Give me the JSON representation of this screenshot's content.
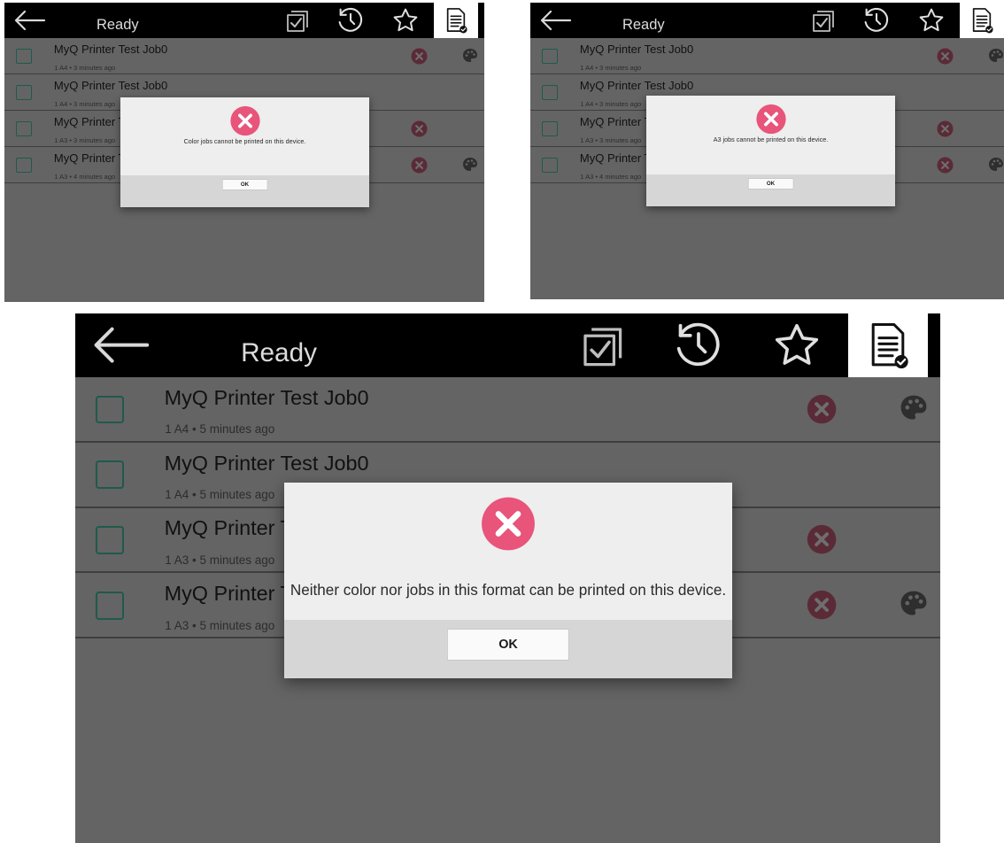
{
  "screens": [
    {
      "topbar": {
        "title": "Ready"
      },
      "jobs": [
        {
          "name": "MyQ Printer Test Job0",
          "meta": "1 A4 • 3 minutes ago",
          "error": true,
          "color": true
        },
        {
          "name": "MyQ Printer Test Job0",
          "meta": "1 A4 • 3 minutes ago",
          "error": false,
          "color": false
        },
        {
          "name": "MyQ Printer Te",
          "meta": "1 A3 • 3 minutes ago",
          "error": true,
          "color": false
        },
        {
          "name": "MyQ Printer Te",
          "meta": "1 A3 • 4 minutes ago",
          "error": true,
          "color": true
        }
      ],
      "dialog": {
        "icon": "error-icon",
        "message": "Color jobs cannot be printed on this device.",
        "ok_label": "OK"
      }
    },
    {
      "topbar": {
        "title": "Ready"
      },
      "jobs": [
        {
          "name": "MyQ Printer Test Job0",
          "meta": "1 A4 • 3 minutes ago",
          "error": true,
          "color": true
        },
        {
          "name": "MyQ Printer Test Job0",
          "meta": "1 A4 • 3 minutes ago",
          "error": false,
          "color": false
        },
        {
          "name": "MyQ Printer Te",
          "meta": "1 A3 • 3 minutes ago",
          "error": true,
          "color": false
        },
        {
          "name": "MyQ Printer Te",
          "meta": "1 A3 • 4 minutes ago",
          "error": true,
          "color": true
        }
      ],
      "dialog": {
        "icon": "error-icon",
        "message": "A3 jobs cannot be printed on this device.",
        "ok_label": "OK"
      }
    },
    {
      "topbar": {
        "title": "Ready"
      },
      "jobs": [
        {
          "name": "MyQ Printer Test Job0",
          "meta": "1 A4 • 5 minutes ago",
          "error": true,
          "color": true
        },
        {
          "name": "MyQ Printer Test Job0",
          "meta": "1 A4 • 5 minutes ago",
          "error": false,
          "color": false
        },
        {
          "name": "MyQ Printer Te",
          "meta": "1 A3 • 5 minutes ago",
          "error": true,
          "color": false
        },
        {
          "name": "MyQ Printer Te",
          "meta": "1 A3 • 5 minutes ago",
          "error": true,
          "color": true
        }
      ],
      "dialog": {
        "icon": "error-icon",
        "message": "Neither color nor jobs in this format can be printed on this device.",
        "ok_label": "OK"
      }
    }
  ],
  "icons": {
    "topbar": [
      "back-arrow-icon",
      "select-all-icon",
      "history-icon",
      "favorites-star-icon",
      "ready-jobs-icon"
    ],
    "job_error": "error-icon",
    "job_color": "color-palette-icon"
  },
  "colors": {
    "overlay": "#646464",
    "topbar": "#000000",
    "checkbox_border": "#1f5a4c",
    "error_red": "#e8547a",
    "dialog_bg": "#eeeeee",
    "dialog_footer": "#d6d6d6"
  }
}
